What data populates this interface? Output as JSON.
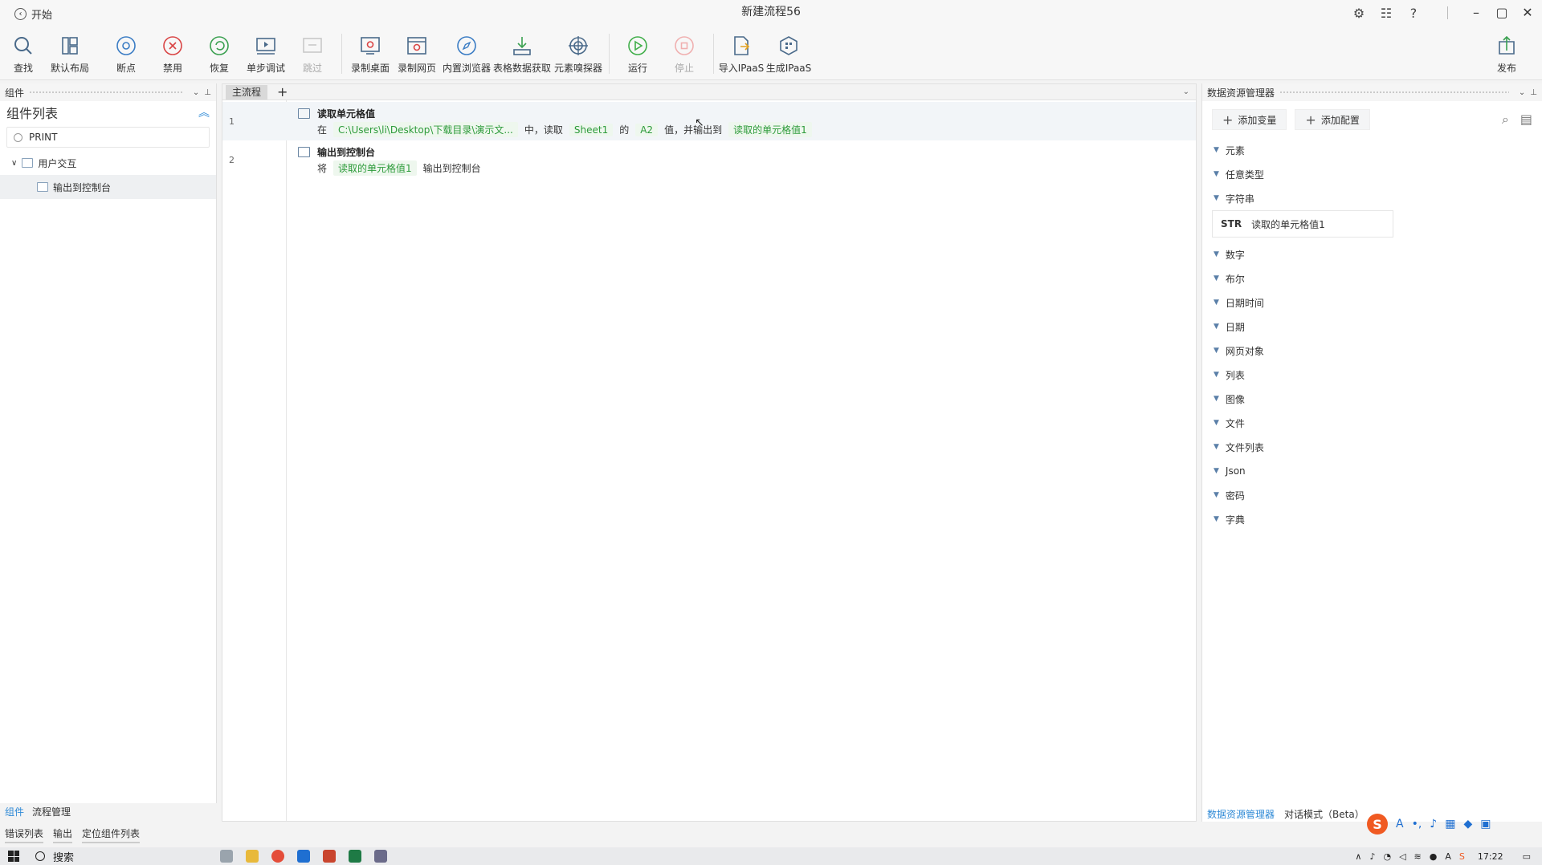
{
  "titlebar": {
    "back_label": "开始",
    "title": "新建流程56"
  },
  "toolbar": {
    "find": "查找",
    "default_layout": "默认布局",
    "breakpoint": "断点",
    "disable": "禁用",
    "restore": "恢复",
    "step_debug": "单步调试",
    "skip": "跳过",
    "record_desktop": "录制桌面",
    "record_web": "录制网页",
    "builtin_browser": "内置浏览器",
    "table_data": "表格数据获取",
    "element_sniffer": "元素嗅探器",
    "run": "运行",
    "stop": "停止",
    "import_ipaas": "导入IPaaS",
    "generate_ipaas": "生成IPaaS",
    "publish": "发布"
  },
  "left_panel": {
    "header": "组件",
    "title": "组件列表",
    "search_value": "PRINT",
    "group_label": "用户交互",
    "item_label": "输出到控制台",
    "bottom_tabs": [
      "组件",
      "流程管理"
    ]
  },
  "editor": {
    "tab_label": "主流程",
    "steps": [
      {
        "line": "1",
        "title": "读取单元格值",
        "parts": {
          "p1": "在",
          "file": "C:\\Users\\li\\Desktop\\下载目录\\演示文...",
          "p2": "中，读取",
          "sheet": "Sheet1",
          "p3": "的",
          "cell": "A2",
          "p4": "值，并输出到",
          "var": "读取的单元格值1"
        }
      },
      {
        "line": "2",
        "title": "输出到控制台",
        "parts": {
          "p1": "将",
          "var": "读取的单元格值1",
          "p2": "输出到控制台"
        }
      }
    ]
  },
  "right_panel": {
    "header": "数据资源管理器",
    "add_variable": "添加变量",
    "add_config": "添加配置",
    "categories_top": [
      "元素",
      "任意类型",
      "字符串"
    ],
    "variable": {
      "type": "STR",
      "name": "读取的单元格值1"
    },
    "categories_bottom": [
      "数字",
      "布尔",
      "日期时间",
      "日期",
      "网页对象",
      "列表",
      "图像",
      "文件",
      "文件列表",
      "Json",
      "密码",
      "字典"
    ],
    "bottom_tabs": [
      "数据资源管理器",
      "对话模式（Beta）"
    ]
  },
  "bottom_tabs": [
    "错误列表",
    "输出",
    "定位组件列表"
  ],
  "taskbar": {
    "search_label": "搜索",
    "time": "17:22"
  },
  "colors": {
    "accent": "#2f8ad6",
    "chip_green": "#2d9b3a",
    "run_green": "#3fae49",
    "stop_red": "#e24a4a"
  }
}
